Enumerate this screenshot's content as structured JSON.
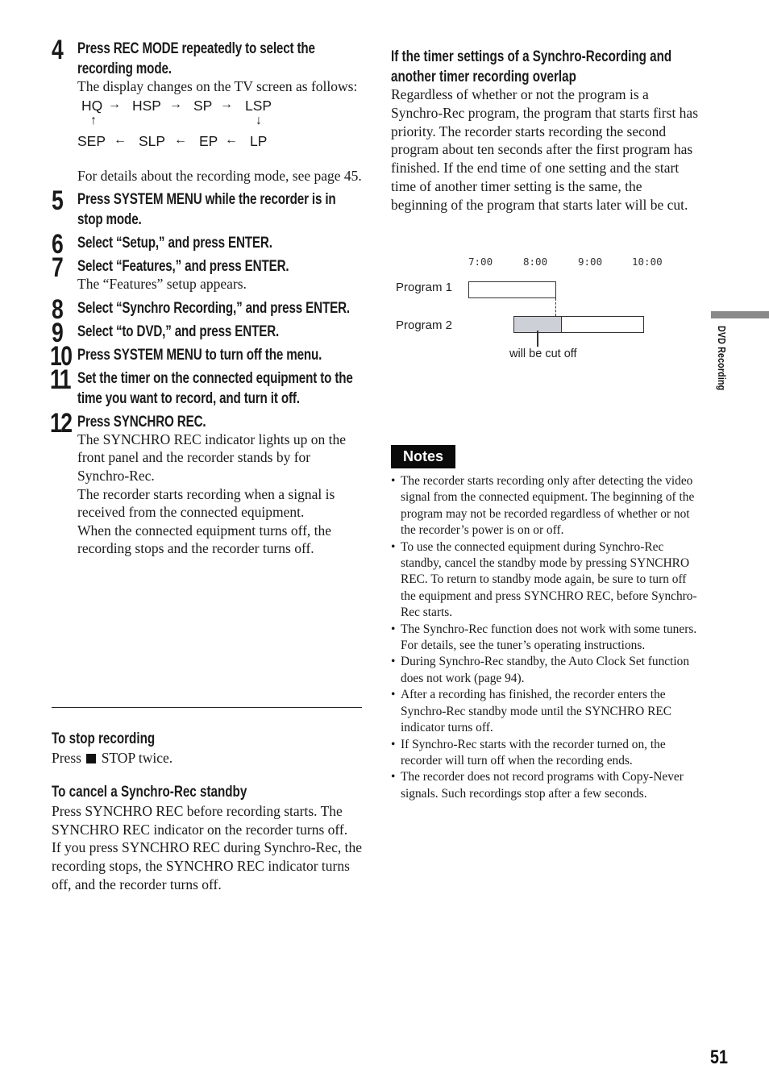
{
  "steps": [
    {
      "number": "4",
      "title": "Press REC MODE repeatedly to select the recording mode.",
      "body_before": "The display changes on the TV screen as follows:",
      "body_after": "For details about the recording mode, see page 45."
    },
    {
      "number": "5",
      "title": "Press SYSTEM MENU while the recorder is in stop mode."
    },
    {
      "number": "6",
      "title": "Select “Setup,” and press ENTER."
    },
    {
      "number": "7",
      "title": "Select “Features,” and press ENTER.",
      "body": "The “Features” setup appears."
    },
    {
      "number": "8",
      "title": "Select “Synchro Recording,” and press ENTER."
    },
    {
      "number": "9",
      "title": "Select “to DVD,” and press ENTER."
    },
    {
      "number": "10",
      "title": "Press SYSTEM MENU to turn off the menu."
    },
    {
      "number": "11",
      "title": "Set the timer on the connected equipment to the time you want to record, and turn it off."
    },
    {
      "number": "12",
      "title": "Press SYNCHRO REC.",
      "body": [
        "The SYNCHRO REC indicator lights up on the front panel and the recorder stands by for Synchro-Rec.",
        "The recorder starts recording when a signal is received from the connected equipment.",
        "When the connected equipment turns off, the recording stops and the recorder turns off."
      ]
    }
  ],
  "recording_modes": {
    "top_row": [
      "HQ",
      "HSP",
      "SP",
      "LSP"
    ],
    "bottom_row": [
      "SEP",
      "SLP",
      "EP",
      "LP"
    ],
    "arrow_right": "→",
    "arrow_left": "←",
    "arrow_up": "↑",
    "arrow_down": "↓"
  },
  "to_stop": {
    "heading": "To stop recording",
    "text_before": "Press",
    "stop_icon": "stop-square-icon",
    "text_after": "STOP twice."
  },
  "to_cancel": {
    "heading": "To cancel a Synchro-Rec standby",
    "paragraphs": [
      "Press SYNCHRO REC before recording starts. The SYNCHRO REC indicator on the recorder turns off.",
      "If you press SYNCHRO REC during Synchro-Rec, the recording stops, the SYNCHRO REC indicator turns off, and the recorder turns off."
    ]
  },
  "overlap": {
    "heading": "If the timer settings of a Synchro-Recording and another timer recording overlap",
    "text": "Regardless of whether or not the program is a Synchro-Rec program, the program that starts first has priority. The recorder starts recording the second program about ten seconds after the first program has finished. If the end time of one setting and the start time of another timer setting is the same, the beginning of the program that starts later will be cut."
  },
  "timeline": {
    "ticks": [
      "7:00",
      "8:00",
      "9:00",
      "10:00"
    ],
    "programs": [
      {
        "label": "Program 1",
        "start_hour": 7.0,
        "end_hour": 8.6
      },
      {
        "label": "Program 2",
        "start_hour": 7.83,
        "end_hour": 10.2,
        "cut_until_hour": 8.7
      }
    ],
    "cut_label": "will be cut off",
    "cut_color": "#cdd0d6"
  },
  "notes": {
    "badge": "Notes",
    "items": [
      "The recorder starts recording only after detecting the video signal from the connected equipment. The beginning of the program may not be recorded regardless of whether or not the recorder’s power is on or off.",
      "To use the connected equipment during Synchro-Rec standby, cancel the standby mode by pressing SYNCHRO REC. To return to standby mode again, be sure to turn off the equipment and press SYNCHRO REC, before Synchro-Rec starts.",
      "The Synchro-Rec function does not work with some tuners. For details, see the tuner’s operating instructions.",
      "During Synchro-Rec standby, the Auto Clock Set function does not work (page 94).",
      "After a recording has finished, the recorder enters the Synchro-Rec standby mode until the SYNCHRO REC indicator turns off.",
      "If Synchro-Rec starts with the recorder turned on, the recorder will turn off when the recording ends.",
      "The recorder does not record programs with Copy-Never signals. Such recordings stop after a few seconds."
    ],
    "bullet": "•"
  },
  "side_tab": {
    "label": "DVD Recording",
    "color": "#8a8a8a"
  },
  "page_number": "51"
}
